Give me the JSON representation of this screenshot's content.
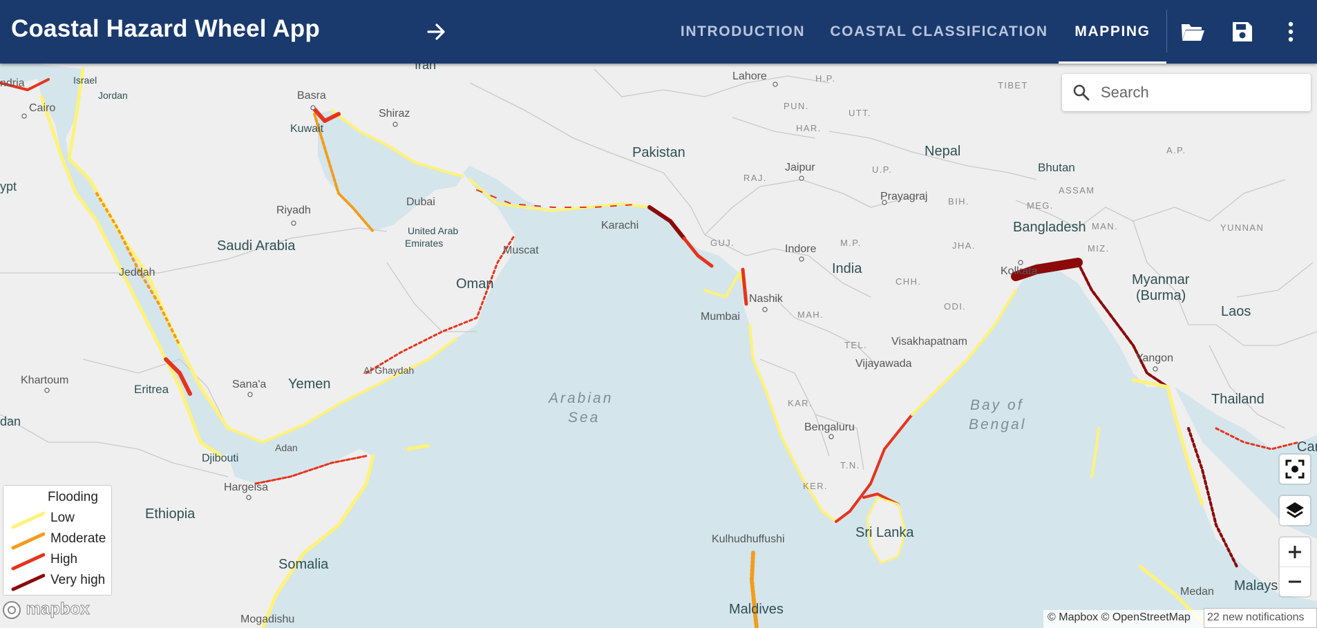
{
  "app": {
    "title": "Coastal Hazard Wheel App"
  },
  "nav": {
    "tabs": [
      {
        "label": "INTRODUCTION",
        "active": false
      },
      {
        "label": "COASTAL CLASSIFICATION",
        "active": false
      },
      {
        "label": "MAPPING",
        "active": true
      }
    ],
    "icons": [
      "arrow-right-icon",
      "folder-open-icon",
      "save-icon",
      "more-vert-icon"
    ]
  },
  "search": {
    "placeholder": "Search"
  },
  "map": {
    "countries": [
      "Pakistan",
      "Nepal",
      "Bhutan",
      "Bangladesh",
      "India",
      "Myanmar",
      "(Burma)",
      "Laos",
      "Thailand",
      "Camb",
      "Saudi Arabia",
      "Oman",
      "Yemen",
      "Ethiopia",
      "Somalia",
      "Sri Lanka",
      "Maldives",
      "Eritrea",
      "Djibouti",
      "ypt",
      "dan",
      "Malays"
    ],
    "seas": {
      "arabian_1": "Arabian",
      "arabian_2": "Sea",
      "bengal_1": "Bay of",
      "bengal_2": "Bengal"
    },
    "cities": [
      "Lahore",
      "Basra",
      "Shiraz",
      "Kuwait",
      "Dubai",
      "United Arab",
      "Emirates",
      "Riyadh",
      "Muscat",
      "Karachi",
      "Jaipur",
      "Prayagraj",
      "Indore",
      "Nashik",
      "Mumbai",
      "Visakhapatnam",
      "Vijayawada",
      "Bengaluru",
      "Yangon",
      "Khartoum",
      "Sana'a",
      "Al Ghaydah",
      "Adan",
      "Hargeisa",
      "Jeddah",
      "Cairo",
      "Jordan",
      "Israel",
      "Iran",
      "Kulhudhuffushi",
      "Mogadishu",
      "Medan",
      "Kolkata",
      "ndria"
    ],
    "regions": [
      "H.P.",
      "PUN.",
      "UTT.",
      "HAR.",
      "U.P.",
      "RAJ.",
      "BIH.",
      "ASSAM",
      "MEG.",
      "MAN.",
      "GUJ.",
      "M.P.",
      "JHA.",
      "MIZ.",
      "CHH.",
      "ODI.",
      "MAH.",
      "TEL.",
      "KAR.",
      "T.N.",
      "KER.",
      "TIBET",
      "YUNNAN",
      "A.P."
    ]
  },
  "legend": {
    "title": "Flooding",
    "items": [
      {
        "label": "Low",
        "color": "#fff27a"
      },
      {
        "label": "Moderate",
        "color": "#f39c1b"
      },
      {
        "label": "High",
        "color": "#e5341d"
      },
      {
        "label": "Very high",
        "color": "#8b0a0a"
      }
    ]
  },
  "controls": [
    "fullscreen-icon",
    "layers-icon",
    "zoom-in-icon",
    "zoom-out-icon"
  ],
  "attribution": {
    "logo": "mapbox",
    "text": "© Mapbox © OpenStreetMap"
  },
  "notification": {
    "text": "22 new notifications"
  },
  "colors": {
    "appbar": "#1a3a6e",
    "water": "#d4e5ec",
    "land": "#efefef"
  }
}
